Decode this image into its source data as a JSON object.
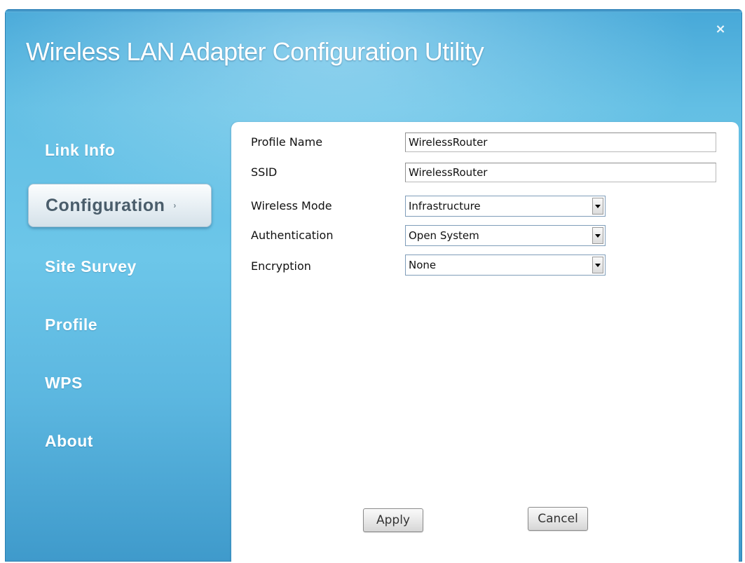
{
  "window": {
    "title": "Wireless LAN Adapter Configuration Utility",
    "close_glyph": "×"
  },
  "nav": {
    "items": [
      {
        "label": "Link Info",
        "active": false
      },
      {
        "label": "Configuration",
        "active": true
      },
      {
        "label": "Site Survey",
        "active": false
      },
      {
        "label": "Profile",
        "active": false
      },
      {
        "label": "WPS",
        "active": false
      },
      {
        "label": "About",
        "active": false
      }
    ],
    "active_arrow": "›"
  },
  "form": {
    "profile_name": {
      "label": "Profile Name",
      "value": "WirelessRouter"
    },
    "ssid": {
      "label": "SSID",
      "value": "WirelessRouter"
    },
    "wireless_mode": {
      "label": "Wireless Mode",
      "value": "Infrastructure"
    },
    "authentication": {
      "label": "Authentication",
      "value": "Open System"
    },
    "encryption": {
      "label": "Encryption",
      "value": "None"
    }
  },
  "buttons": {
    "apply": "Apply",
    "cancel": "Cancel"
  },
  "colors": {
    "window_blue": "#5cb7e0",
    "panel_bg": "#ffffff",
    "nav_text": "#ffffff",
    "active_nav_text": "#4a5d6b"
  },
  "icons": {
    "close": "close-icon",
    "dropdown": "chevron-down-icon",
    "nav_arrow": "chevron-right-icon"
  }
}
